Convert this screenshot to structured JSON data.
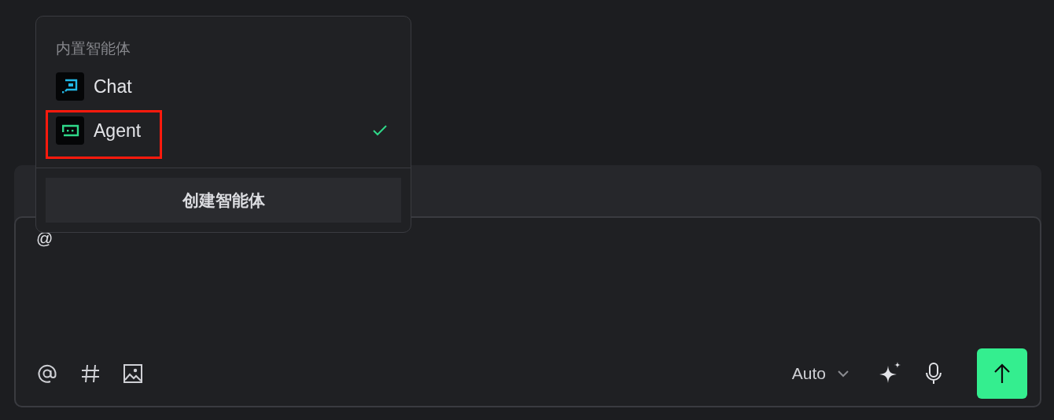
{
  "agent_menu": {
    "section_title": "内置智能体",
    "items": [
      {
        "label": "Chat",
        "kind": "chat",
        "selected": false,
        "highlighted": false
      },
      {
        "label": "Agent",
        "kind": "agent",
        "selected": true,
        "highlighted": true
      }
    ],
    "create_button": "创建智能体"
  },
  "composer": {
    "value": "@",
    "model": "Auto"
  }
}
